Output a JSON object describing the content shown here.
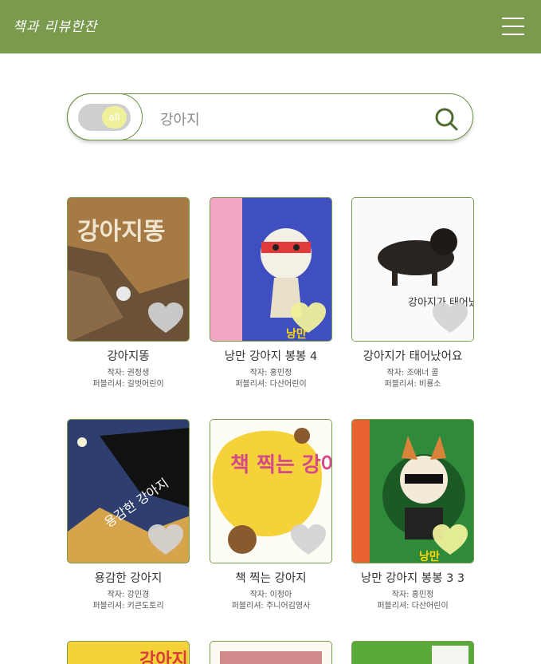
{
  "header": {
    "logo_text": "책과 리뷰한잔",
    "menu_icon": "hamburger-icon"
  },
  "search": {
    "toggle_label": "all",
    "query": "강아지",
    "icon": "search-icon"
  },
  "books": [
    {
      "title": "강아지똥",
      "author": "작자: 권정생",
      "publisher": "퍼블리셔: 길벗어린이",
      "cover_text": "강아지똥"
    },
    {
      "title": "낭만 강아지 봉봉 4",
      "author": "작자: 홍민정",
      "publisher": "퍼블리셔: 다산어린이",
      "cover_text": "낭만"
    },
    {
      "title": "강아지가 태어났어요",
      "author": "작자: 조애너 콜",
      "publisher": "퍼블리셔: 비룡소",
      "cover_text": "강아지가 태어났"
    },
    {
      "title": "용감한 강아지",
      "author": "작자: 강민경",
      "publisher": "퍼블리셔: 키큰도토리",
      "cover_text": "용감한 강아지"
    },
    {
      "title": "책 찍는 강아지",
      "author": "작자: 이정아",
      "publisher": "퍼블리셔: 주니어김영사",
      "cover_text": "책 찍는 강아지"
    },
    {
      "title": "낭만 강아지 봉봉 3 3",
      "author": "작자: 홍민정",
      "publisher": "퍼블리셔: 다산어린이",
      "cover_text": "낭만"
    }
  ],
  "partial_covers": [
    {
      "cover_text": "강아지"
    },
    {
      "cover_text": ""
    },
    {
      "cover_text": ""
    }
  ],
  "colors": {
    "header": "#7a9a4e",
    "heart": "#d3d3d3",
    "heart_selected": "#eef09a"
  }
}
